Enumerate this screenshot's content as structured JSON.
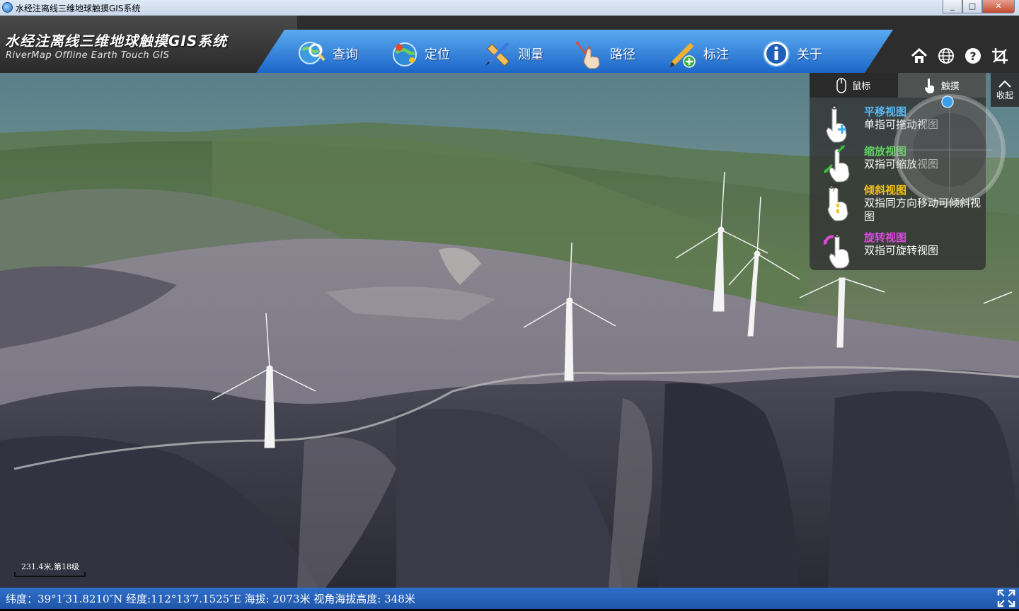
{
  "window": {
    "title": "水经注离线三维地球触摸GIS系统",
    "minimize": "_",
    "maximize": "□",
    "close": "✕"
  },
  "header": {
    "brand_main": "水经注离线三维地球触摸GIS系统",
    "brand_sub": "RiverMap Offline Earth Touch GIS",
    "nav": [
      {
        "icon": "search-globe-icon",
        "label": "查询"
      },
      {
        "icon": "locate-globe-icon",
        "label": "定位"
      },
      {
        "icon": "ruler-pencil-icon",
        "label": "测量"
      },
      {
        "icon": "route-hand-icon",
        "label": "路径"
      },
      {
        "icon": "annotate-pencil-icon",
        "label": "标注"
      },
      {
        "icon": "info-icon",
        "label": "关于"
      }
    ],
    "tools": [
      "home-icon",
      "globe-icon",
      "help-icon",
      "crop-icon"
    ]
  },
  "touch_panel": {
    "tab_mouse": "鼠标",
    "tab_touch": "触摸",
    "active_tab": "触摸",
    "items": [
      {
        "title": "平移视图",
        "desc": "单指可拖动视图",
        "color": "#5bb8f0"
      },
      {
        "title": "缩放视图",
        "desc": "双指可缩放视图",
        "color": "#5fd35f"
      },
      {
        "title": "倾斜视图",
        "desc": "双指同方向移动可倾斜视图",
        "color": "#f2c418"
      },
      {
        "title": "旋转视图",
        "desc": "双指可旋转视图",
        "color": "#d84ad8"
      }
    ]
  },
  "collapse": {
    "label": "收起"
  },
  "map": {
    "scale_label": "231.4米,第18级"
  },
  "status": {
    "text": "纬度：39°1′31.8210″N 经度:112°13′7.1525″E   海拔: 2073米   视角海拔高度: 348米"
  },
  "colors": {
    "header_blue": "#1d66c8",
    "status_blue": "#2f6fc9"
  }
}
